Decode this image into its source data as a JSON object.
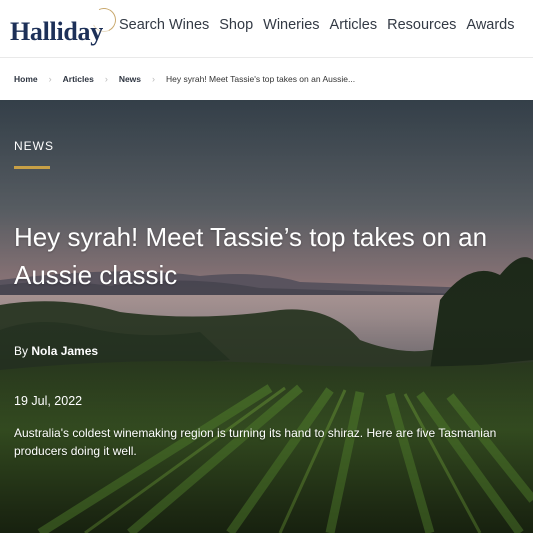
{
  "site": {
    "logo_text": "Halliday"
  },
  "nav": {
    "items": [
      "Search Wines",
      "Shop",
      "Wineries",
      "Articles",
      "Resources",
      "Awards"
    ]
  },
  "breadcrumb": {
    "home": "Home",
    "articles": "Articles",
    "news": "News",
    "current": "Hey syrah! Meet Tassie's top takes on an Aussie..."
  },
  "article": {
    "category": "NEWS",
    "title": "Hey syrah! Meet Tassie’s top takes on an Aussie classic",
    "byline_prefix": "By",
    "author": "Nola James",
    "date": "19 Jul, 2022",
    "summary": "Australia's coldest winemaking region is turning its hand to shiraz. Here are five Tasmanian producers doing it well."
  },
  "colors": {
    "brand_navy": "#1d3058",
    "accent_gold": "#c8a046"
  },
  "icons": {
    "breadcrumb_separator": "chevron-right-icon",
    "logo_mark": "logo-ring-icon"
  }
}
